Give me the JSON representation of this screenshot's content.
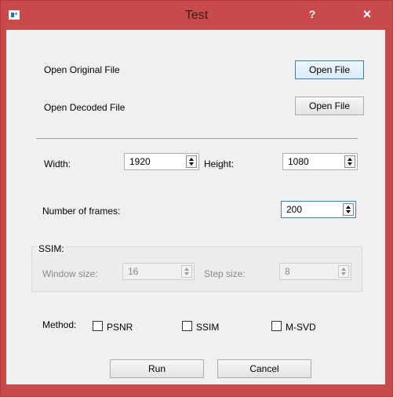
{
  "window": {
    "title": "Test",
    "help": "?",
    "close": "×"
  },
  "files": {
    "original_label": "Open Original File",
    "original_button": "Open File",
    "decoded_label": "Open Decoded File",
    "decoded_button": "Open File"
  },
  "dimensions": {
    "width_label": "Width:",
    "width_value": "1920",
    "height_label": "Height:",
    "height_value": "1080"
  },
  "frames": {
    "label": "Number of frames:",
    "value": "200"
  },
  "ssim": {
    "group_title": "SSIM:",
    "window_label": "Window size:",
    "window_value": "16",
    "step_label": "Step size:",
    "step_value": "8"
  },
  "method": {
    "label": "Method:",
    "options": [
      {
        "label": "PSNR",
        "checked": false
      },
      {
        "label": "SSIM",
        "checked": false
      },
      {
        "label": "M-SVD",
        "checked": false
      }
    ]
  },
  "actions": {
    "run": "Run",
    "cancel": "Cancel"
  }
}
